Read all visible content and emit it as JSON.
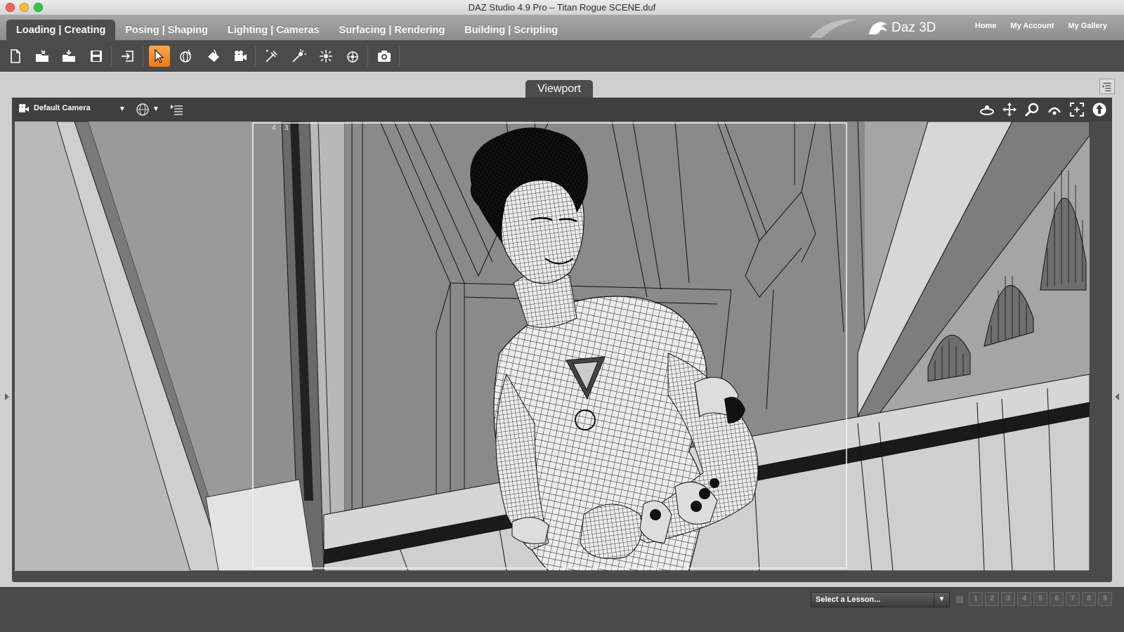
{
  "window": {
    "title": "DAZ Studio 4.9 Pro – Titan Rogue SCENE.duf"
  },
  "tabs": [
    {
      "label": "Loading | Creating",
      "active": true
    },
    {
      "label": "Posing | Shaping",
      "active": false
    },
    {
      "label": "Lighting | Cameras",
      "active": false
    },
    {
      "label": "Surfacing | Rendering",
      "active": false
    },
    {
      "label": "Building | Scripting",
      "active": false
    }
  ],
  "brand": {
    "name": "Daz 3D"
  },
  "top_links": [
    "Home",
    "My Account",
    "My Gallery"
  ],
  "toolbar": {
    "tools": [
      "new-file-icon",
      "open-file-icon",
      "merge-file-icon",
      "save-file-icon",
      "import-icon",
      "node-selection-icon",
      "universal-tool-icon",
      "surface-selection-icon",
      "camera-node-icon",
      "spotlight-icon",
      "point-light-icon",
      "distant-light-icon",
      "ambient-light-icon",
      "render-icon"
    ],
    "active_tool": "node-selection-icon",
    "accent_color": "#f58a22"
  },
  "viewport": {
    "tab_label": "Viewport",
    "camera_label": "Default Camera",
    "aspect_label": "4 : 3",
    "draw_style": "wireframe",
    "nav_tools": [
      "orbit-icon",
      "pan-icon",
      "zoom-icon",
      "roll-icon",
      "frame-icon",
      "align-icon"
    ]
  },
  "bottom": {
    "lesson_placeholder": "Select a Lesson...",
    "steps": [
      "1",
      "2",
      "3",
      "4",
      "5",
      "6",
      "7",
      "8",
      "9"
    ]
  }
}
